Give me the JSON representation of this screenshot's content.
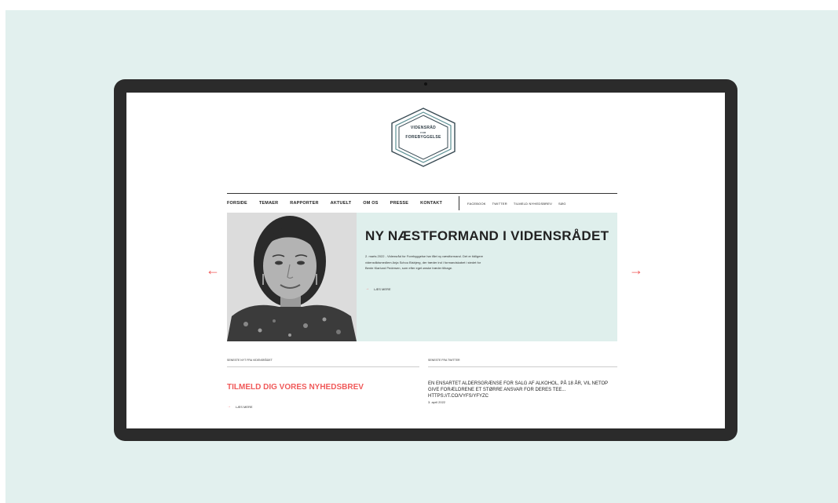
{
  "logo": {
    "line1": "VIDENSRÅD",
    "line2": "FOR",
    "line3": "FOREBYGGELSE"
  },
  "nav": {
    "main": [
      "FORSIDE",
      "TEMAER",
      "RAPPORTER",
      "AKTUELT",
      "OM OS",
      "PRESSE",
      "KONTAKT"
    ],
    "social": [
      "FACEBOOK",
      "TWITTER",
      "TILMELD NYHEDSBREV",
      "SØG"
    ]
  },
  "hero": {
    "title": "NY NÆSTFORMAND I VIDENSRÅDET",
    "text": "2. marts 2022 - Vidensråd for Forebyggelse har fået ny næstformand. Det er tidligere vidensrådsmedlem Anja Schou Bisbjerg, der træder ind i formandskabet i stedet for Bente Klarlund Pedersen, som efter eget ønske træder tilbage.",
    "readmore": "LÆS MERE"
  },
  "columns": {
    "left_head": "SENESTE NYT FRA VIDENSRÅDET",
    "newsletter": "TILMELD DIG VORES NYHEDSBREV",
    "readmore": "LÆS MERE",
    "right_head": "SENESTE FRA TWITTER",
    "tweet": "EN ENSARTET ALDERSGRÆNSE FOR SALG AF ALKOHOL, PÅ 18 ÅR, VIL NETOP GIVE FORÆLDRENE ET STØRRE ANSVAR FOR DERES TEE... HTTPS://T.CO/VYFS/YFYZC",
    "tweet_date": "3. april 2022"
  },
  "icons": {
    "prev": "arrow-left-icon",
    "next": "arrow-right-icon",
    "arrow_prev_glyph": "←",
    "arrow_next_glyph": "→",
    "readmore_glyph": "→"
  },
  "colors": {
    "accent": "#f05a5a",
    "hero_bg": "#dfefec",
    "page_bg": "#e2f0ee",
    "device_frame": "#2b2b2b"
  }
}
